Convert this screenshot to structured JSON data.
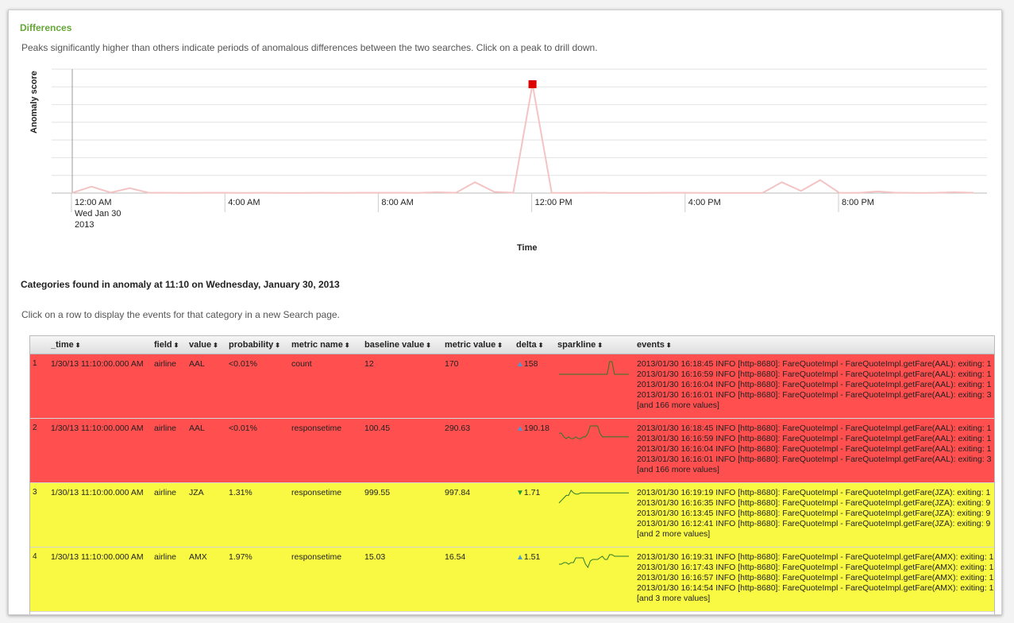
{
  "panel": {
    "title": "Differences",
    "subtitle": "Peaks significantly higher than others indicate periods of anomalous differences between the two searches. Click on a peak to drill down."
  },
  "chart_data": {
    "type": "line",
    "ylabel": "Anomaly score",
    "xlabel": "Time",
    "x_tick_labels": [
      [
        "12:00 AM",
        "Wed Jan 30",
        "2013"
      ],
      [
        "4:00 AM"
      ],
      [
        "8:00 AM"
      ],
      [
        "12:00 PM"
      ],
      [
        "4:00 PM"
      ],
      [
        "8:00 PM"
      ]
    ],
    "x_hours": [
      0,
      0.5,
      1,
      1.5,
      2,
      2.5,
      3,
      3.5,
      4,
      4.5,
      5,
      5.5,
      6,
      6.5,
      7,
      7.5,
      8,
      8.5,
      9,
      9.5,
      10,
      10.5,
      11,
      11.5,
      12,
      12.5,
      13,
      13.5,
      14,
      14.5,
      15,
      15.5,
      16,
      16.5,
      17,
      17.5,
      18,
      18.5,
      19,
      19.5,
      20,
      20.5,
      21,
      21.5,
      22,
      22.5,
      23,
      23.5
    ],
    "values": [
      0.2,
      6,
      0.5,
      4.5,
      0.3,
      0.3,
      0.2,
      0.3,
      0.3,
      0.2,
      0.3,
      0.2,
      0.2,
      0.3,
      0.2,
      0.3,
      0.3,
      0.3,
      0.2,
      0.8,
      0.3,
      10,
      1.2,
      0.3,
      100,
      0.3,
      0.2,
      0.3,
      0.2,
      0.2,
      0.2,
      0.3,
      0.3,
      0.2,
      0.2,
      0.2,
      0.2,
      10,
      2,
      12,
      0.3,
      0.2,
      1.5,
      0.3,
      0.2,
      0.3,
      0.8,
      0.3
    ],
    "highlight_index": 24,
    "ylim": [
      0,
      100
    ],
    "series_color": "#f4c4c4",
    "highlight_color": "#dd0000"
  },
  "categories": {
    "heading": "Categories found in anomaly at 11:10 on Wednesday, January 30, 2013",
    "instructions": "Click on a row to display the events for that category in a new Search page."
  },
  "table": {
    "columns": [
      "_time",
      "field",
      "value",
      "probability",
      "metric name",
      "baseline value",
      "metric value",
      "delta",
      "sparkline",
      "events"
    ],
    "sort_icon": "⬍",
    "rows": [
      {
        "num": "1",
        "time": "1/30/13 11:10:00.000 AM",
        "field": "airline",
        "value": "AAL",
        "probability": "<0.01%",
        "metric": "count",
        "baseline": "12",
        "metric_value": "170",
        "delta_dir": "up",
        "delta": "158",
        "color": "red",
        "spark": [
          5,
          5,
          5,
          5,
          5,
          5,
          5,
          5,
          5,
          5,
          5,
          5,
          5,
          5,
          5,
          5,
          5,
          5,
          5,
          5,
          5,
          18,
          18,
          5,
          5,
          5,
          5,
          5,
          5,
          5
        ],
        "events": [
          "2013/01/30 16:18:45 INFO [http-8680]: FareQuoteImpl - FareQuoteImpl.getFare(AAL): exiting: 1",
          "2013/01/30 16:16:59 INFO [http-8680]: FareQuoteImpl - FareQuoteImpl.getFare(AAL): exiting: 1",
          "2013/01/30 16:16:04 INFO [http-8680]: FareQuoteImpl - FareQuoteImpl.getFare(AAL): exiting: 1",
          "2013/01/30 16:16:01 INFO [http-8680]: FareQuoteImpl - FareQuoteImpl.getFare(AAL): exiting: 3",
          "[and 166 more values]"
        ]
      },
      {
        "num": "2",
        "time": "1/30/13 11:10:00.000 AM",
        "field": "airline",
        "value": "AAL",
        "probability": "<0.01%",
        "metric": "responsetime",
        "baseline": "100.45",
        "metric_value": "290.63",
        "delta_dir": "up",
        "delta": "190.18",
        "color": "red",
        "spark": [
          8,
          8,
          6,
          5,
          6,
          5,
          5,
          6,
          5,
          5,
          6,
          6,
          8,
          12,
          12,
          12,
          12,
          8,
          6,
          6,
          6,
          6,
          6,
          6,
          6,
          6,
          6,
          6,
          6,
          6
        ],
        "events": [
          "2013/01/30 16:18:45 INFO [http-8680]: FareQuoteImpl - FareQuoteImpl.getFare(AAL): exiting: 1",
          "2013/01/30 16:16:59 INFO [http-8680]: FareQuoteImpl - FareQuoteImpl.getFare(AAL): exiting: 1",
          "2013/01/30 16:16:04 INFO [http-8680]: FareQuoteImpl - FareQuoteImpl.getFare(AAL): exiting: 1",
          "2013/01/30 16:16:01 INFO [http-8680]: FareQuoteImpl - FareQuoteImpl.getFare(AAL): exiting: 3",
          "[and 166 more values]"
        ]
      },
      {
        "num": "3",
        "time": "1/30/13 11:10:00.000 AM",
        "field": "airline",
        "value": "JZA",
        "probability": "1.31%",
        "metric": "responsetime",
        "baseline": "999.55",
        "metric_value": "997.84",
        "delta_dir": "down",
        "delta": "1.71",
        "color": "yellow",
        "spark": [
          2,
          4,
          6,
          8,
          8,
          12,
          10,
          9,
          9,
          10,
          10,
          10,
          10,
          10,
          10,
          10,
          10,
          10,
          10,
          10,
          10,
          10,
          10,
          10,
          10,
          10,
          10,
          10,
          10,
          10
        ],
        "events": [
          "2013/01/30 16:19:19 INFO [http-8680]: FareQuoteImpl - FareQuoteImpl.getFare(JZA): exiting: 1",
          "2013/01/30 16:16:35 INFO [http-8680]: FareQuoteImpl - FareQuoteImpl.getFare(JZA): exiting: 9",
          "2013/01/30 16:13:45 INFO [http-8680]: FareQuoteImpl - FareQuoteImpl.getFare(JZA): exiting: 9",
          "2013/01/30 16:12:41 INFO [http-8680]: FareQuoteImpl - FareQuoteImpl.getFare(JZA): exiting: 9",
          "[and 2 more values]"
        ]
      },
      {
        "num": "4",
        "time": "1/30/13 11:10:00.000 AM",
        "field": "airline",
        "value": "AMX",
        "probability": "1.97%",
        "metric": "responsetime",
        "baseline": "15.03",
        "metric_value": "16.54",
        "delta_dir": "up",
        "delta": "1.51",
        "color": "yellow",
        "spark": [
          6,
          6,
          7,
          7,
          6,
          7,
          7,
          10,
          10,
          10,
          10,
          6,
          4,
          8,
          9,
          9,
          9,
          10,
          11,
          9,
          9,
          12,
          12,
          11,
          11,
          11,
          11,
          11,
          11,
          11
        ],
        "events": [
          "2013/01/30 16:19:31 INFO [http-8680]: FareQuoteImpl - FareQuoteImpl.getFare(AMX): exiting: 1",
          "2013/01/30 16:17:43 INFO [http-8680]: FareQuoteImpl - FareQuoteImpl.getFare(AMX): exiting: 1",
          "2013/01/30 16:16:57 INFO [http-8680]: FareQuoteImpl - FareQuoteImpl.getFare(AMX): exiting: 1",
          "2013/01/30 16:14:54 INFO [http-8680]: FareQuoteImpl - FareQuoteImpl.getFare(AMX): exiting: 1",
          "[and 3 more values]"
        ]
      }
    ]
  }
}
